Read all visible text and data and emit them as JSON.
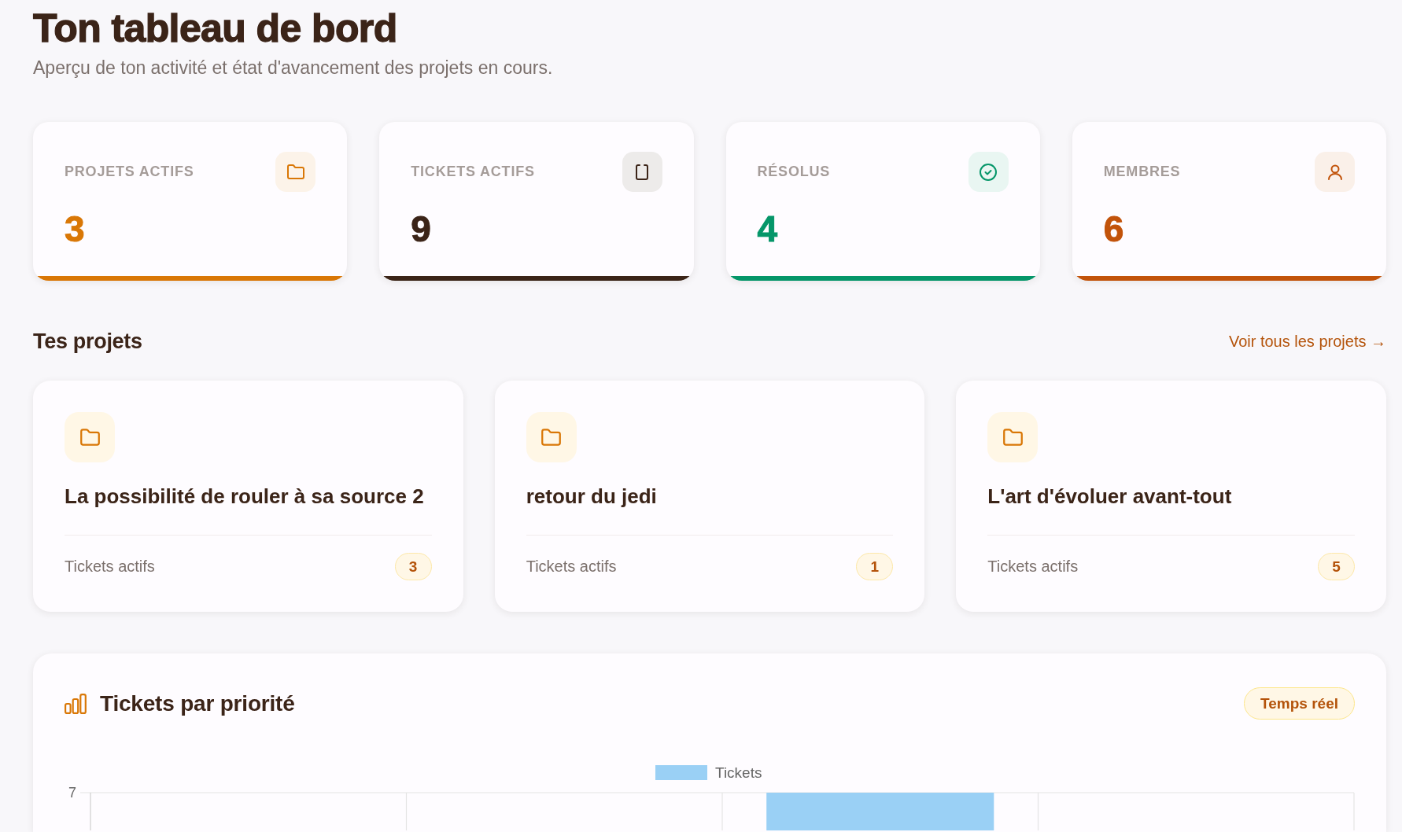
{
  "header": {
    "title": "Ton tableau de bord",
    "subtitle": "Aperçu de ton activité et état d'avancement des projets en cours."
  },
  "stats": [
    {
      "label": "PROJETS ACTIFS",
      "value": "3",
      "color": "#d97706"
    },
    {
      "label": "TICKETS ACTIFS",
      "value": "9",
      "color": "#3b2418"
    },
    {
      "label": "RÉSOLUS",
      "value": "4",
      "color": "#059669"
    },
    {
      "label": "MEMBRES",
      "value": "6",
      "color": "#c2530a"
    }
  ],
  "projects_section": {
    "title": "Tes projets",
    "link": "Voir tous les projets →",
    "projects": [
      {
        "name": "La possibilité de rouler à sa source 2",
        "tickets_label": "Tickets actifs",
        "ticket_count": "3"
      },
      {
        "name": "retour du jedi",
        "tickets_label": "Tickets actifs",
        "ticket_count": "1"
      },
      {
        "name": "L'art d'évoluer avant-tout",
        "tickets_label": "Tickets actifs",
        "ticket_count": "5"
      }
    ]
  },
  "priority_panel": {
    "title": "Tickets par priorité",
    "badge": "Temps réel",
    "chart_legend": "Tickets",
    "chart_axis_label": "7"
  }
}
